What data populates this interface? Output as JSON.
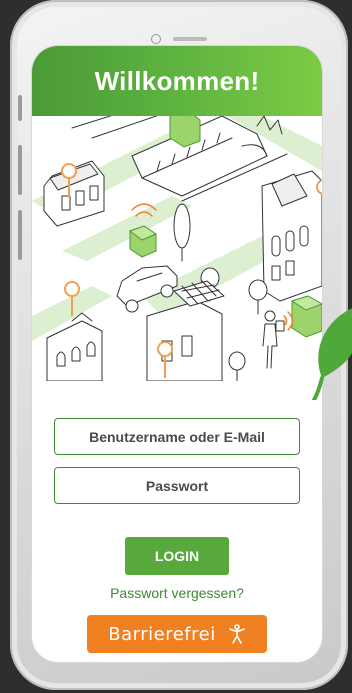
{
  "header": {
    "title": "Willkommen!"
  },
  "login": {
    "username_placeholder": "Benutzername oder E-Mail",
    "password_placeholder": "Passwort",
    "login_label": "LOGIN",
    "forgot_label": "Passwort vergessen?",
    "accessibility_label": "Barrierefrei",
    "accessibility_icon": "accessibility-person-icon"
  },
  "colors": {
    "header_start": "#4a9a36",
    "header_end": "#7ccb45",
    "primary_green": "#58a93c",
    "accent_orange": "#f08022",
    "pin_orange": "#f0a050"
  }
}
